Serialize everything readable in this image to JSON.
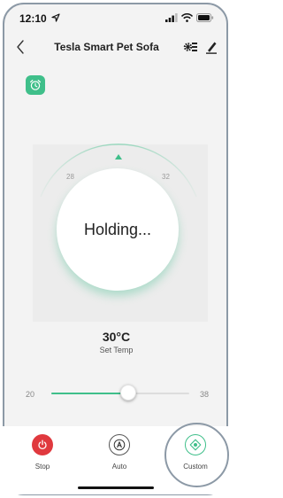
{
  "status_bar": {
    "time": "12:10",
    "icons": [
      "location-arrow-icon",
      "signal-icon",
      "wifi-icon",
      "battery-icon"
    ]
  },
  "nav": {
    "title": "Tesla Smart Pet Sofa",
    "icons": [
      "back-chevron-icon",
      "device-settings-icon",
      "edit-pencil-icon"
    ]
  },
  "alarm": {
    "icon": "alarm-clock-icon",
    "color": "#3fbf8a"
  },
  "dial": {
    "tick_left": "28",
    "tick_right": "32",
    "status_text": "Holding...",
    "accent_color": "#3fbf8a"
  },
  "temperature": {
    "value": "30°C",
    "caption": "Set Temp"
  },
  "slider": {
    "min_label": "20",
    "max_label": "38",
    "min": 20,
    "max": 38,
    "value": 30
  },
  "modes": [
    {
      "label": "Stop",
      "icon": "power-icon",
      "color": "#e0393e"
    },
    {
      "label": "Auto",
      "icon": "auto-a-icon",
      "color": "#555555"
    },
    {
      "label": "Custom",
      "icon": "target-icon",
      "color": "#3fbf8a",
      "selected": true
    }
  ]
}
